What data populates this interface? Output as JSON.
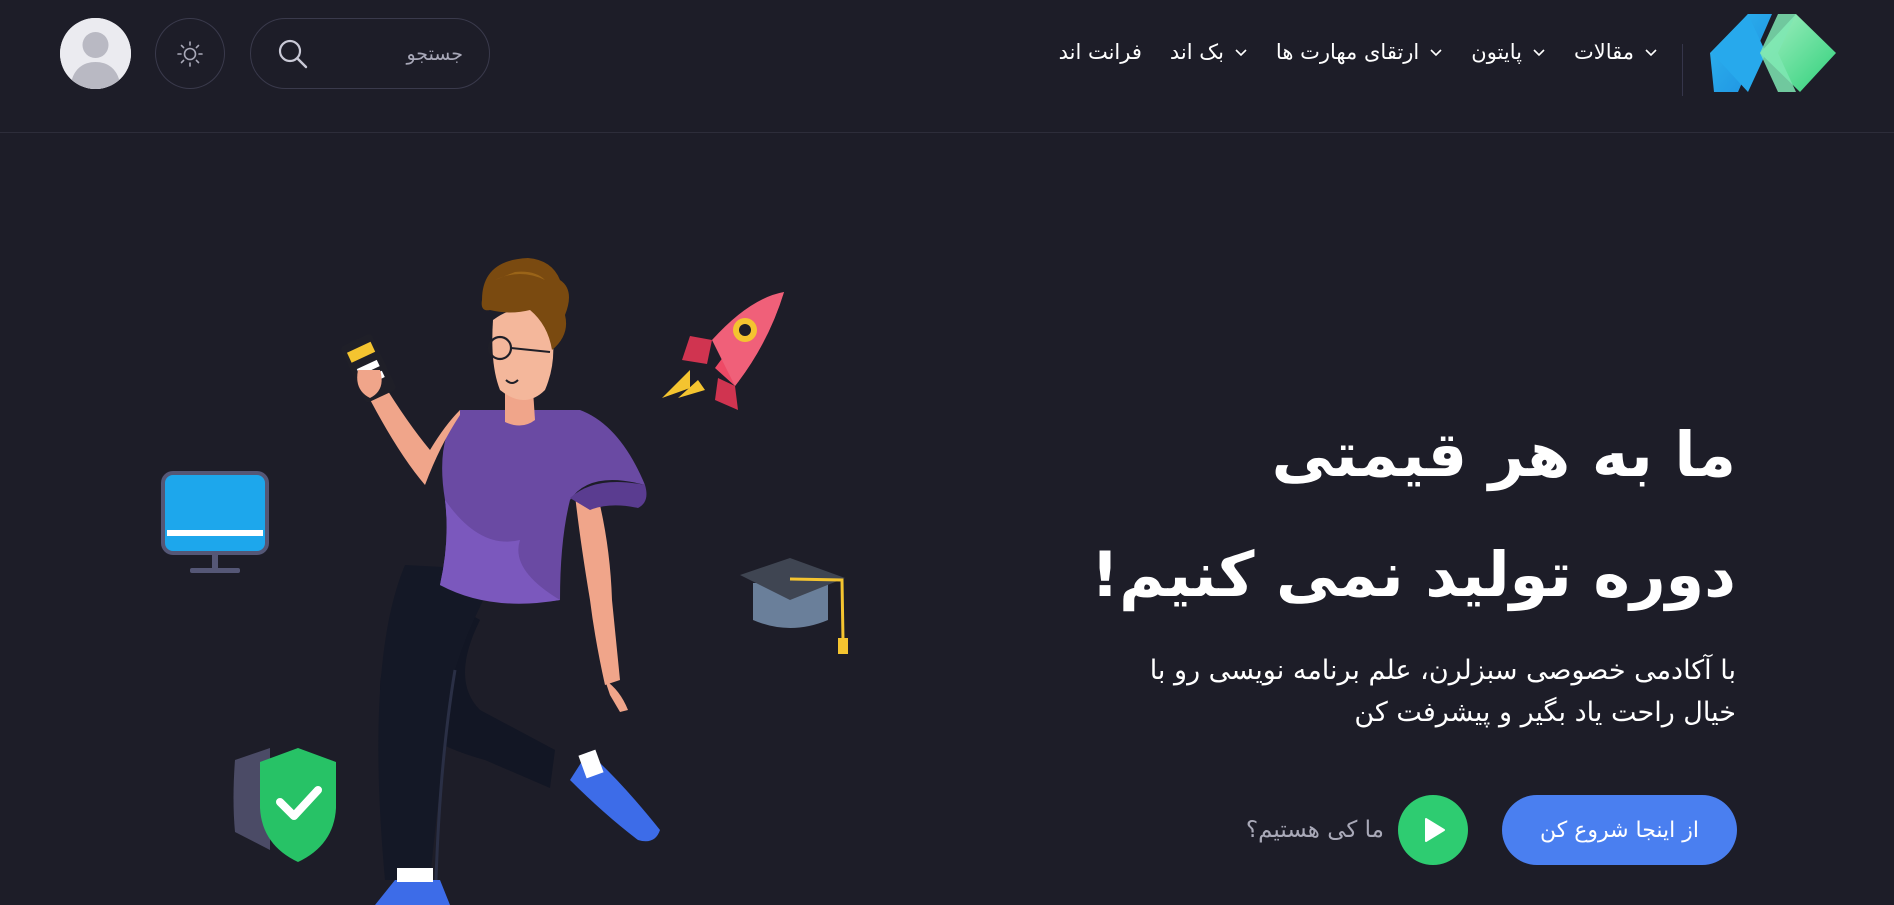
{
  "header": {
    "nav": [
      {
        "label": "فرانت اند",
        "has_dropdown": false
      },
      {
        "label": "بک اند",
        "has_dropdown": true
      },
      {
        "label": "ارتقای مهارت ها",
        "has_dropdown": true
      },
      {
        "label": "پایتون",
        "has_dropdown": true
      },
      {
        "label": "مقالات",
        "has_dropdown": true
      }
    ],
    "search": {
      "placeholder": "جستجو",
      "icon": "search-icon"
    },
    "theme_toggle_icon": "sun-icon",
    "avatar_icon": "user-icon"
  },
  "hero": {
    "title_line1": "ما به هر قیمتی",
    "title_line2": "دوره تولید نمی کنیم!",
    "subtitle_line1": "با آکادمی خصوصی سبزلرن، علم برنامه نویسی رو با",
    "subtitle_line2": "خیال راحت یاد بگیر و پیشرفت کن",
    "cta_label": "از اینجا شروع کن",
    "about_label": "ما کی هستیم؟"
  },
  "colors": {
    "background": "#1d1d28",
    "accent_blue": "#4a7ff0",
    "accent_green": "#2ecc71",
    "muted_text": "#a9a9b8"
  }
}
